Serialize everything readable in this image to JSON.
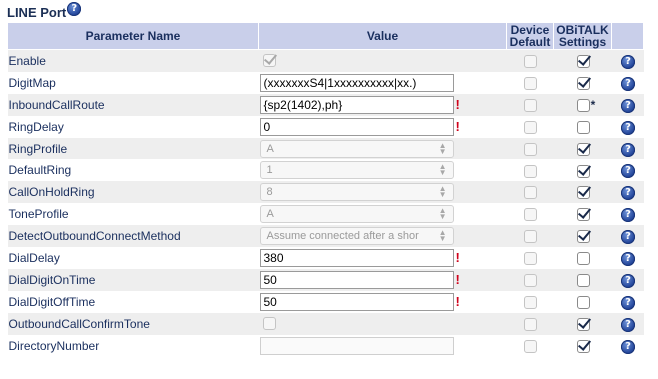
{
  "section": {
    "title": "LINE Port"
  },
  "headers": {
    "parameter_name": "Parameter Name",
    "value": "Value",
    "device_default_line1": "Device",
    "device_default_line2": "Default",
    "obitalk_line1": "OBiTALK",
    "obitalk_line2": "Settings"
  },
  "help_glyph": "?",
  "rows": [
    {
      "name": "Enable",
      "type": "checkbox",
      "value_checked": true,
      "value_disabled": true,
      "error": "",
      "device_default": false,
      "obitalk": true,
      "obitalk_note": ""
    },
    {
      "name": "DigitMap",
      "type": "text",
      "value": "(xxxxxxxS4|1xxxxxxxxxx|xx.)",
      "error": "",
      "device_default": false,
      "obitalk": true,
      "obitalk_note": ""
    },
    {
      "name": "InboundCallRoute",
      "type": "text",
      "value": "{sp2(1402),ph}",
      "error": "!",
      "device_default": false,
      "obitalk": false,
      "obitalk_note": "*"
    },
    {
      "name": "RingDelay",
      "type": "text",
      "value": "0",
      "error": "!",
      "device_default": false,
      "obitalk": false,
      "obitalk_note": ""
    },
    {
      "name": "RingProfile",
      "type": "select",
      "value": "A",
      "error": "",
      "device_default": false,
      "obitalk": true,
      "obitalk_note": ""
    },
    {
      "name": "DefaultRing",
      "type": "select",
      "value": "1",
      "error": "",
      "device_default": false,
      "obitalk": true,
      "obitalk_note": ""
    },
    {
      "name": "CallOnHoldRing",
      "type": "select",
      "value": "8",
      "error": "",
      "device_default": false,
      "obitalk": true,
      "obitalk_note": ""
    },
    {
      "name": "ToneProfile",
      "type": "select",
      "value": "A",
      "error": "",
      "device_default": false,
      "obitalk": true,
      "obitalk_note": ""
    },
    {
      "name": "DetectOutboundConnectMethod",
      "type": "select",
      "value": "Assume connected after a shor",
      "error": "",
      "device_default": false,
      "obitalk": true,
      "obitalk_note": ""
    },
    {
      "name": "DialDelay",
      "type": "text",
      "value": "380",
      "error": "!",
      "device_default": false,
      "obitalk": false,
      "obitalk_note": ""
    },
    {
      "name": "DialDigitOnTime",
      "type": "text",
      "value": "50",
      "error": "!",
      "device_default": false,
      "obitalk": false,
      "obitalk_note": ""
    },
    {
      "name": "DialDigitOffTime",
      "type": "text",
      "value": "50",
      "error": "!",
      "device_default": false,
      "obitalk": false,
      "obitalk_note": ""
    },
    {
      "name": "OutboundCallConfirmTone",
      "type": "checkbox",
      "value_checked": false,
      "value_disabled": true,
      "error": "",
      "device_default": false,
      "obitalk": true,
      "obitalk_note": ""
    },
    {
      "name": "DirectoryNumber",
      "type": "text-disabled",
      "value": "",
      "error": "",
      "device_default": false,
      "obitalk": true,
      "obitalk_note": ""
    }
  ]
}
